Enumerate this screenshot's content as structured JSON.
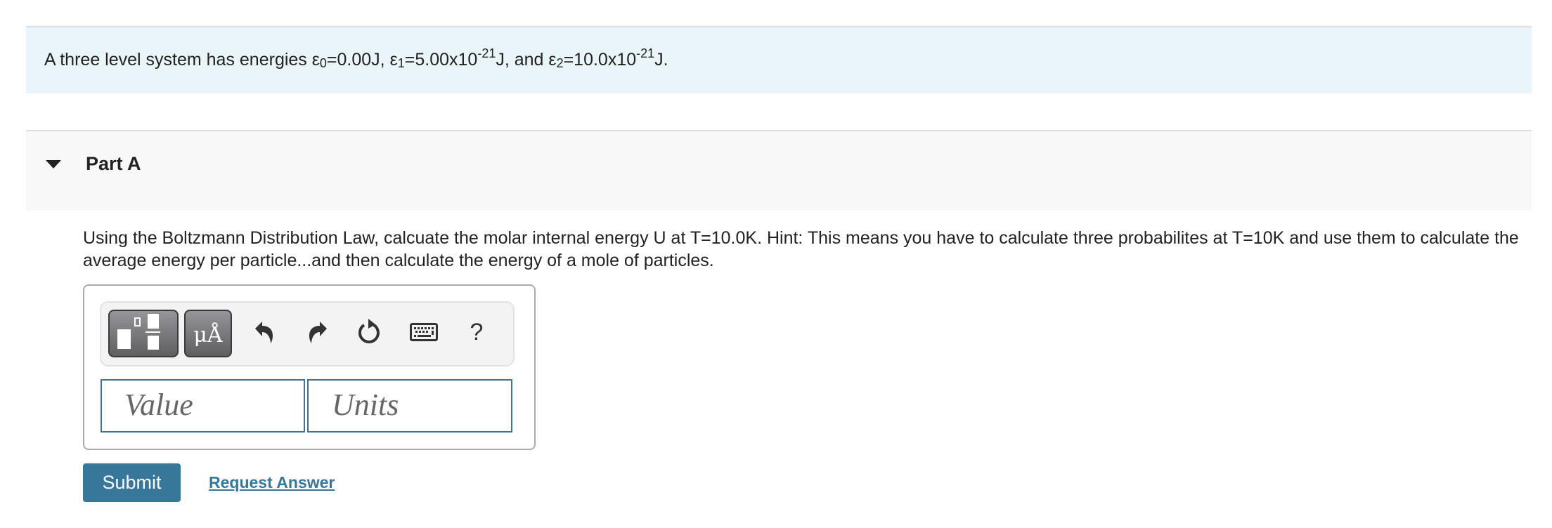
{
  "intro": {
    "prefix": "A three level system has energies ",
    "eps_symbol": "ε",
    "e0_sub": "0",
    "e0_value": "=0.00J, ",
    "e1_sub": "1",
    "e1_value": "=5.00x10",
    "e1_exp": "-21",
    "e1_unit": "J, and ",
    "e2_sub": "2",
    "e2_value": "=10.0x10",
    "e2_exp": "-21",
    "e2_unit": "J."
  },
  "part": {
    "title": "Part A",
    "expanded": true,
    "question": "Using the Boltzmann Distribution Law, calcuate the molar internal energy U at T=10.0K. Hint: This means you have to calculate three probabilites at T=10K and use them to calculate the average energy per particle...and then calculate the energy of a mole of particles."
  },
  "toolbar": {
    "template_icon": "templates-icon",
    "units_label": "μÅ",
    "undo_icon": "undo-icon",
    "redo_icon": "redo-icon",
    "reset_icon": "reset-icon",
    "keyboard_icon": "keyboard-icon",
    "help_label": "?"
  },
  "inputs": {
    "value_placeholder": "Value",
    "value": "",
    "units_placeholder": "Units",
    "units": ""
  },
  "actions": {
    "submit_label": "Submit",
    "request_answer_label": "Request Answer"
  },
  "colors": {
    "accent": "#377799",
    "intro_bg": "#e9f5f8",
    "part_bg": "#f8f8f8"
  }
}
